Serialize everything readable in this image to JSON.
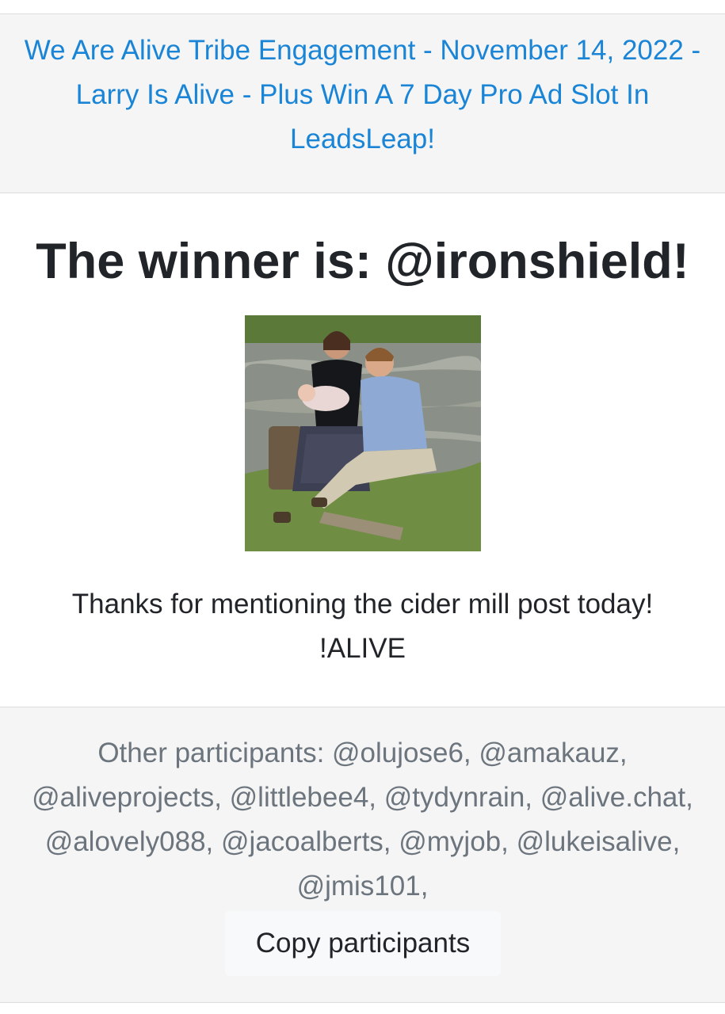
{
  "header": {
    "title_link": "We Are Alive Tribe Engagement - November 14, 2022 - Larry Is Alive - Plus Win A 7 Day Pro Ad Slot In LeadsLeap!"
  },
  "winner": {
    "heading": "The winner is: @ironshield!",
    "photo_alt": "",
    "thanks_line": "Thanks for mentioning the cider mill post today!",
    "tag_line": "!ALIVE"
  },
  "footer": {
    "participants_text": "Other participants: @olujose6, @amakauz, @aliveprojects, @littlebee4, @tydynrain, @alive.chat, @alovely088, @jacoalberts, @myjob, @lukeisalive, @jmis101,",
    "copy_button_label": "Copy participants"
  },
  "colors": {
    "link": "#1a85d6",
    "heading": "#212529",
    "muted": "#6c757d",
    "card_bg": "#f5f5f5"
  }
}
